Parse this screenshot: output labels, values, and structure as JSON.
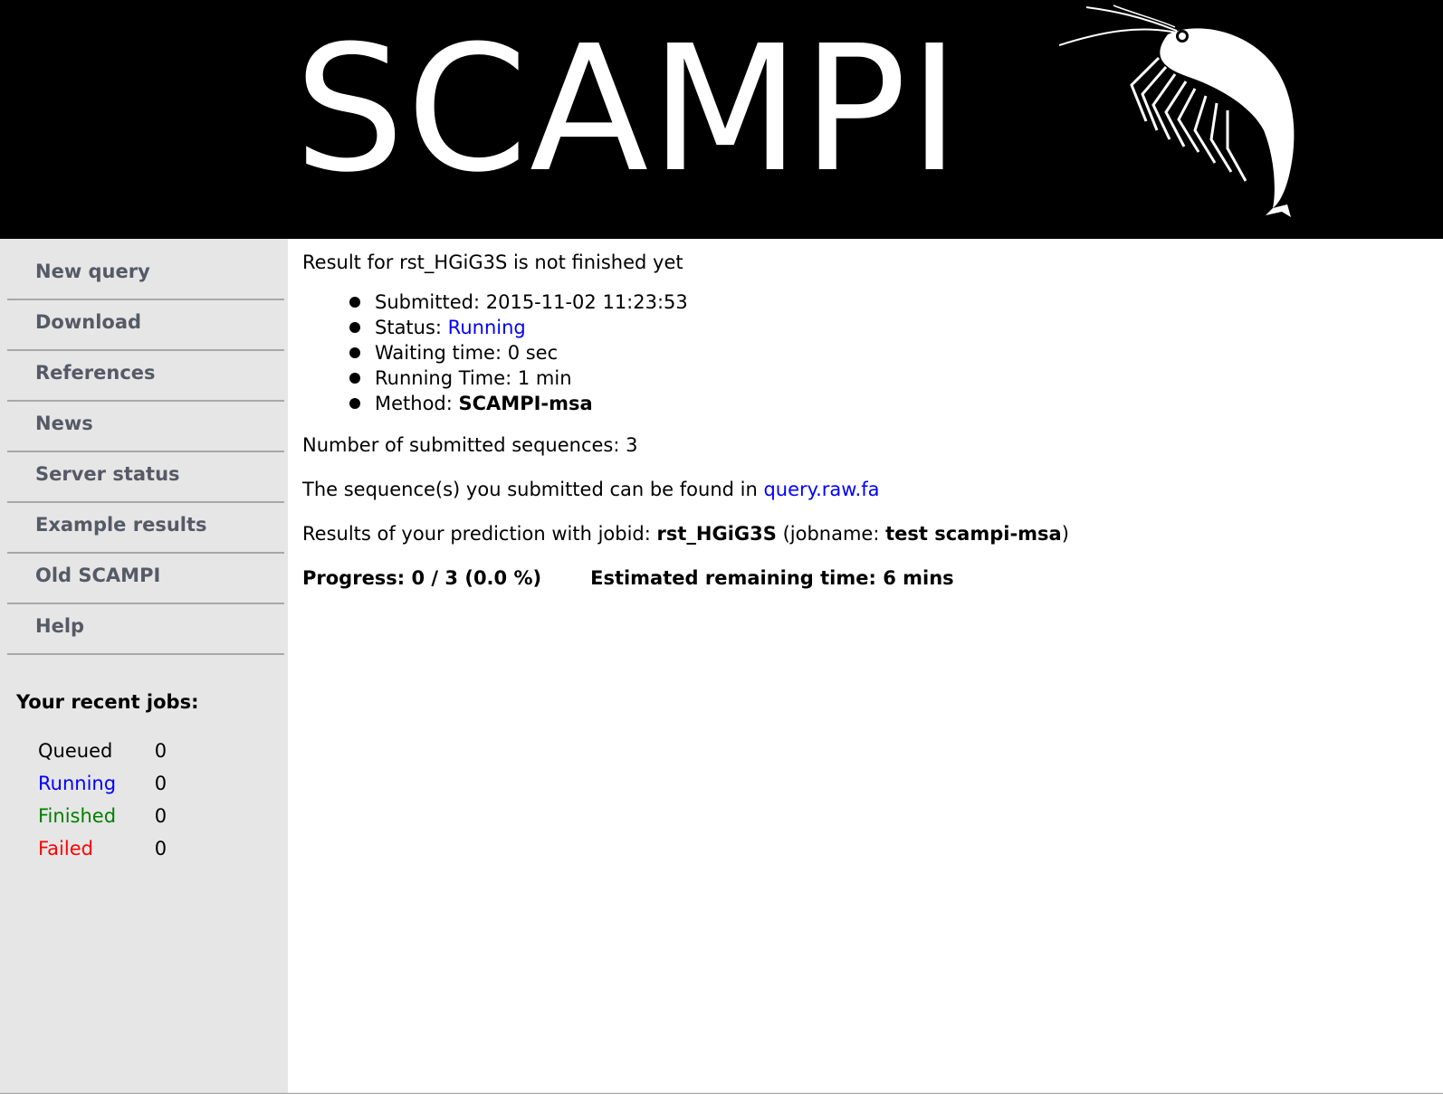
{
  "header": {
    "logo_text": "SCAMPI",
    "logo_image": "krill-icon"
  },
  "sidebar": {
    "nav": [
      {
        "label": "New query"
      },
      {
        "label": "Download"
      },
      {
        "label": "References"
      },
      {
        "label": "News"
      },
      {
        "label": "Server status"
      },
      {
        "label": "Example results"
      },
      {
        "label": "Old SCAMPI"
      },
      {
        "label": "Help"
      }
    ],
    "recent_jobs_title": "Your recent jobs:",
    "jobs": [
      {
        "label": "Queued",
        "count": "0",
        "color": "#000000"
      },
      {
        "label": "Running",
        "count": "0",
        "color": "#0000ff"
      },
      {
        "label": "Finished",
        "count": "0",
        "color": "#008000"
      },
      {
        "label": "Failed",
        "count": "0",
        "color": "#ff0000"
      }
    ]
  },
  "main": {
    "heading": "Result for rst_HGiG3S is not finished yet",
    "details": {
      "submitted_label": "Submitted: ",
      "submitted_value": "2015-11-02 11:23:53",
      "status_label": "Status: ",
      "status_value": "Running",
      "waiting_label": "Waiting time: ",
      "waiting_value": "0 sec",
      "running_label": "Running Time: ",
      "running_value": "1 min",
      "method_label": "Method: ",
      "method_value": "SCAMPI-msa"
    },
    "num_sequences_text": "Number of submitted sequences: 3",
    "found_text": "The sequence(s) you submitted can be found in ",
    "found_link": "query.raw.fa",
    "results_prefix": "Results of your prediction with jobid: ",
    "jobid": "rst_HGiG3S",
    "jobname_prefix": " (jobname: ",
    "jobname": "test scampi-msa",
    "jobname_suffix": ")",
    "progress_text": "Progress: 0 / 3 (0.0 %)",
    "remaining_text": "Estimated remaining time: 6 mins"
  }
}
